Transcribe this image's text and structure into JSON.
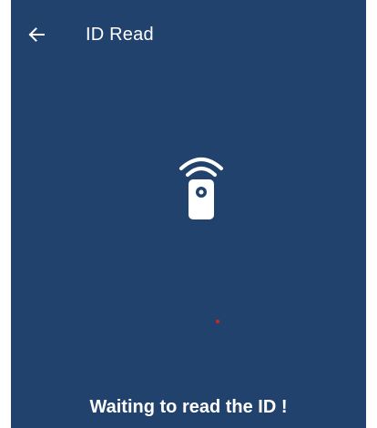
{
  "app_bar": {
    "title": "ID Read",
    "back_icon": "arrow-left-icon"
  },
  "main": {
    "reader_icon": "nfc-reader-icon",
    "status_text": "Waiting to read the ID !"
  },
  "colors": {
    "background": "#22426e",
    "text": "#ffffff",
    "indicator_dot": "#e02020"
  }
}
